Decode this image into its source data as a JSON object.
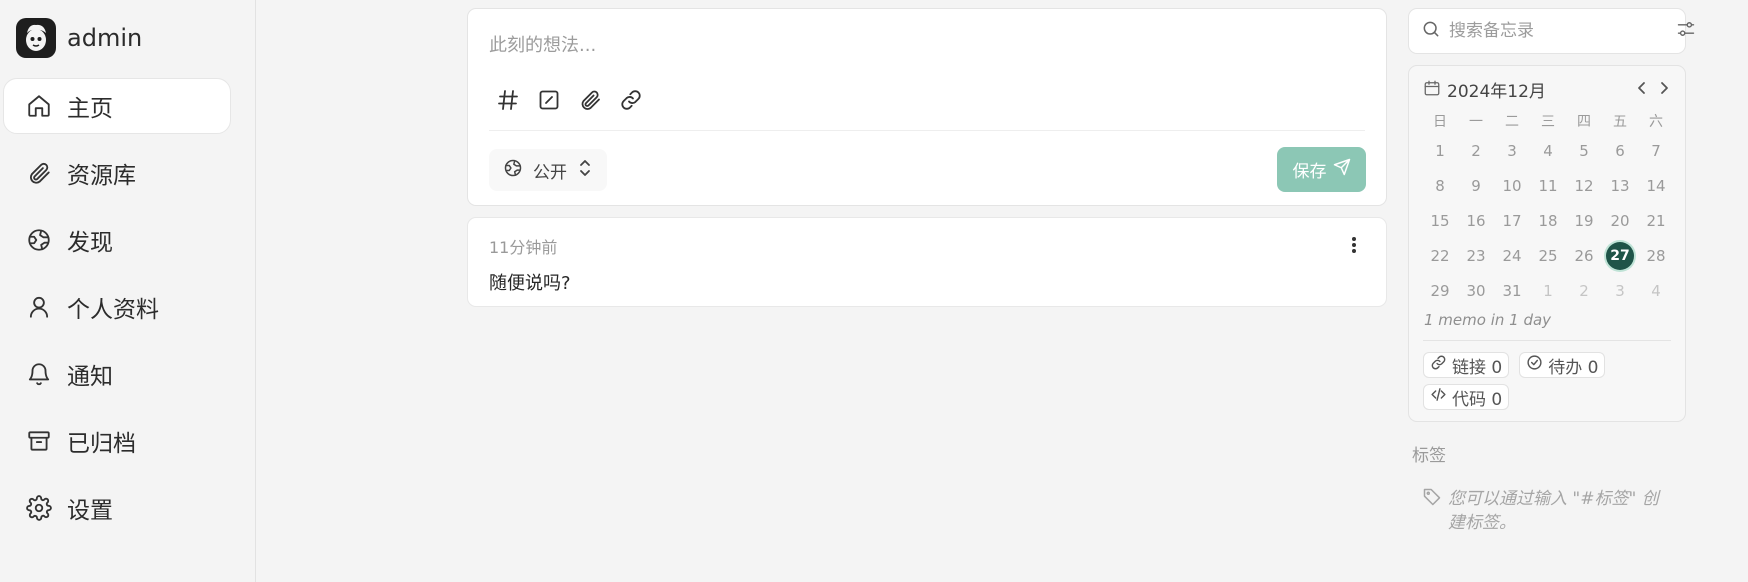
{
  "user": {
    "name": "admin"
  },
  "nav": [
    {
      "label": "主页",
      "icon": "home-icon",
      "active": true
    },
    {
      "label": "资源库",
      "icon": "paperclip-icon"
    },
    {
      "label": "发现",
      "icon": "globe-icon"
    },
    {
      "label": "个人资料",
      "icon": "user-icon"
    },
    {
      "label": "通知",
      "icon": "bell-icon"
    },
    {
      "label": "已归档",
      "icon": "archive-icon"
    },
    {
      "label": "设置",
      "icon": "gear-icon"
    }
  ],
  "editor": {
    "placeholder": "此刻的想法...",
    "toolbar": [
      "hash-icon",
      "checkbox-icon",
      "paperclip-icon",
      "link-icon"
    ],
    "visibility": "公开",
    "save_label": "保存",
    "save_color": "#8cc7b5"
  },
  "memo": {
    "time": "11分钟前",
    "content": "随便说吗?"
  },
  "search": {
    "placeholder": "搜索备忘录"
  },
  "calendar": {
    "title": "2024年12月",
    "weekdays": [
      "日",
      "一",
      "二",
      "三",
      "四",
      "五",
      "六"
    ],
    "days": [
      1,
      2,
      3,
      4,
      5,
      6,
      7,
      8,
      9,
      10,
      11,
      12,
      13,
      14,
      15,
      16,
      17,
      18,
      19,
      20,
      21,
      22,
      23,
      24,
      25,
      26,
      27,
      28,
      29,
      30,
      31
    ],
    "next_month_days": [
      1,
      2,
      3,
      4
    ],
    "today": 27,
    "today_color": "#1f5448",
    "summary": "1 memo in 1 day"
  },
  "stats": {
    "links": "链接 0",
    "todo": "待办 0",
    "code": "代码 0"
  },
  "tags": {
    "title": "标签",
    "hint_line1": "您可以通过输入 \"#标签\" 创",
    "hint_line2": "建标签。"
  }
}
